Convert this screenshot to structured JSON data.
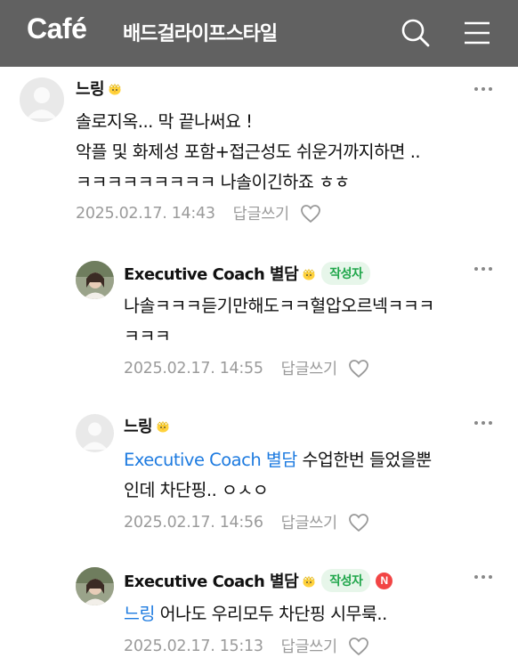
{
  "header": {
    "logo": "Café",
    "cafe_name": "배드걸라이프스타일",
    "icons": {
      "search": "search-icon",
      "menu": "hamburger-menu-icon"
    }
  },
  "labels": {
    "writer_badge": "작성자",
    "reply": "답글쓰기",
    "new_badge": "N"
  },
  "comments": [
    {
      "author": "느링",
      "lines": [
        "솔로지옥... 막 끝나써요 !",
        "악플 및 화제성 포함+접근성도 쉬운거까지하면 ..",
        "ㅋㅋㅋㅋㅋㅋㅋㅋㅋ 나솔이긴하죠 ㅎㅎ"
      ],
      "date": "2025.02.17. 14:43"
    },
    {
      "author": "Executive Coach 별담",
      "lines": [
        "나솔ㅋㅋㅋ듣기만해도ㅋㅋ혈압오르넥ㅋㅋㅋ",
        "ㅋㅋㅋ"
      ],
      "date": "2025.02.17. 14:55"
    },
    {
      "author": "느링",
      "mention": "Executive Coach 별담",
      "line1_rest": " 수업한번 들었을뿐",
      "line2": "인데 차단핑.. ㅇㅅㅇ",
      "date": "2025.02.17. 14:56"
    },
    {
      "author": "Executive Coach 별담",
      "mention": "느링",
      "line1_rest": " 어나도 우리모두 차단핑 시무룩..",
      "date": "2025.02.17. 15:13"
    }
  ]
}
